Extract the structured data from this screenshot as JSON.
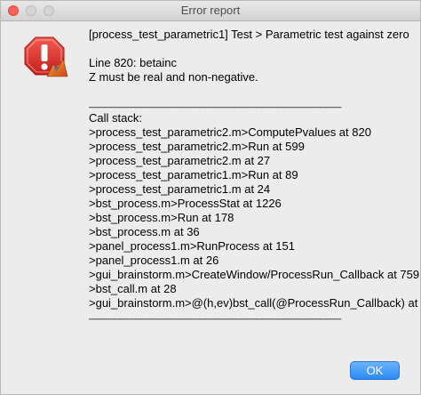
{
  "window": {
    "title": "Error report"
  },
  "message": {
    "header": "[process_test_parametric1]  Test > Parametric test against zero",
    "line_info": "Line 820:  betainc",
    "detail": "Z must be real and non-negative.",
    "separator_top": "________________________________________________",
    "call_stack_label": "Call stack:",
    "call_stack": [
      ">process_test_parametric2.m>ComputePvalues at 820",
      ">process_test_parametric2.m>Run at 599",
      ">process_test_parametric2.m at 27",
      ">process_test_parametric1.m>Run at 89",
      ">process_test_parametric1.m at 24",
      ">bst_process.m>ProcessStat at 1226",
      ">bst_process.m>Run at 178",
      ">bst_process.m at 36",
      ">panel_process1.m>RunProcess at 151",
      ">panel_process1.m at 26",
      ">gui_brainstorm.m>CreateWindow/ProcessRun_Callback at 759",
      ">bst_call.m at 28",
      ">gui_brainstorm.m>@(h,ev)bst_call(@ProcessRun_Callback) at 292"
    ],
    "separator_bottom": "________________________________________________"
  },
  "buttons": {
    "ok_label": "OK"
  },
  "icons": {
    "window_close": "close-icon",
    "window_minimize": "minimize-icon",
    "window_zoom": "zoom-icon",
    "alert": "warning-stop-icon"
  },
  "colors": {
    "close_red": "#fc605b",
    "alert_red": "#e0302c",
    "ok_blue": "#2a8af6"
  }
}
